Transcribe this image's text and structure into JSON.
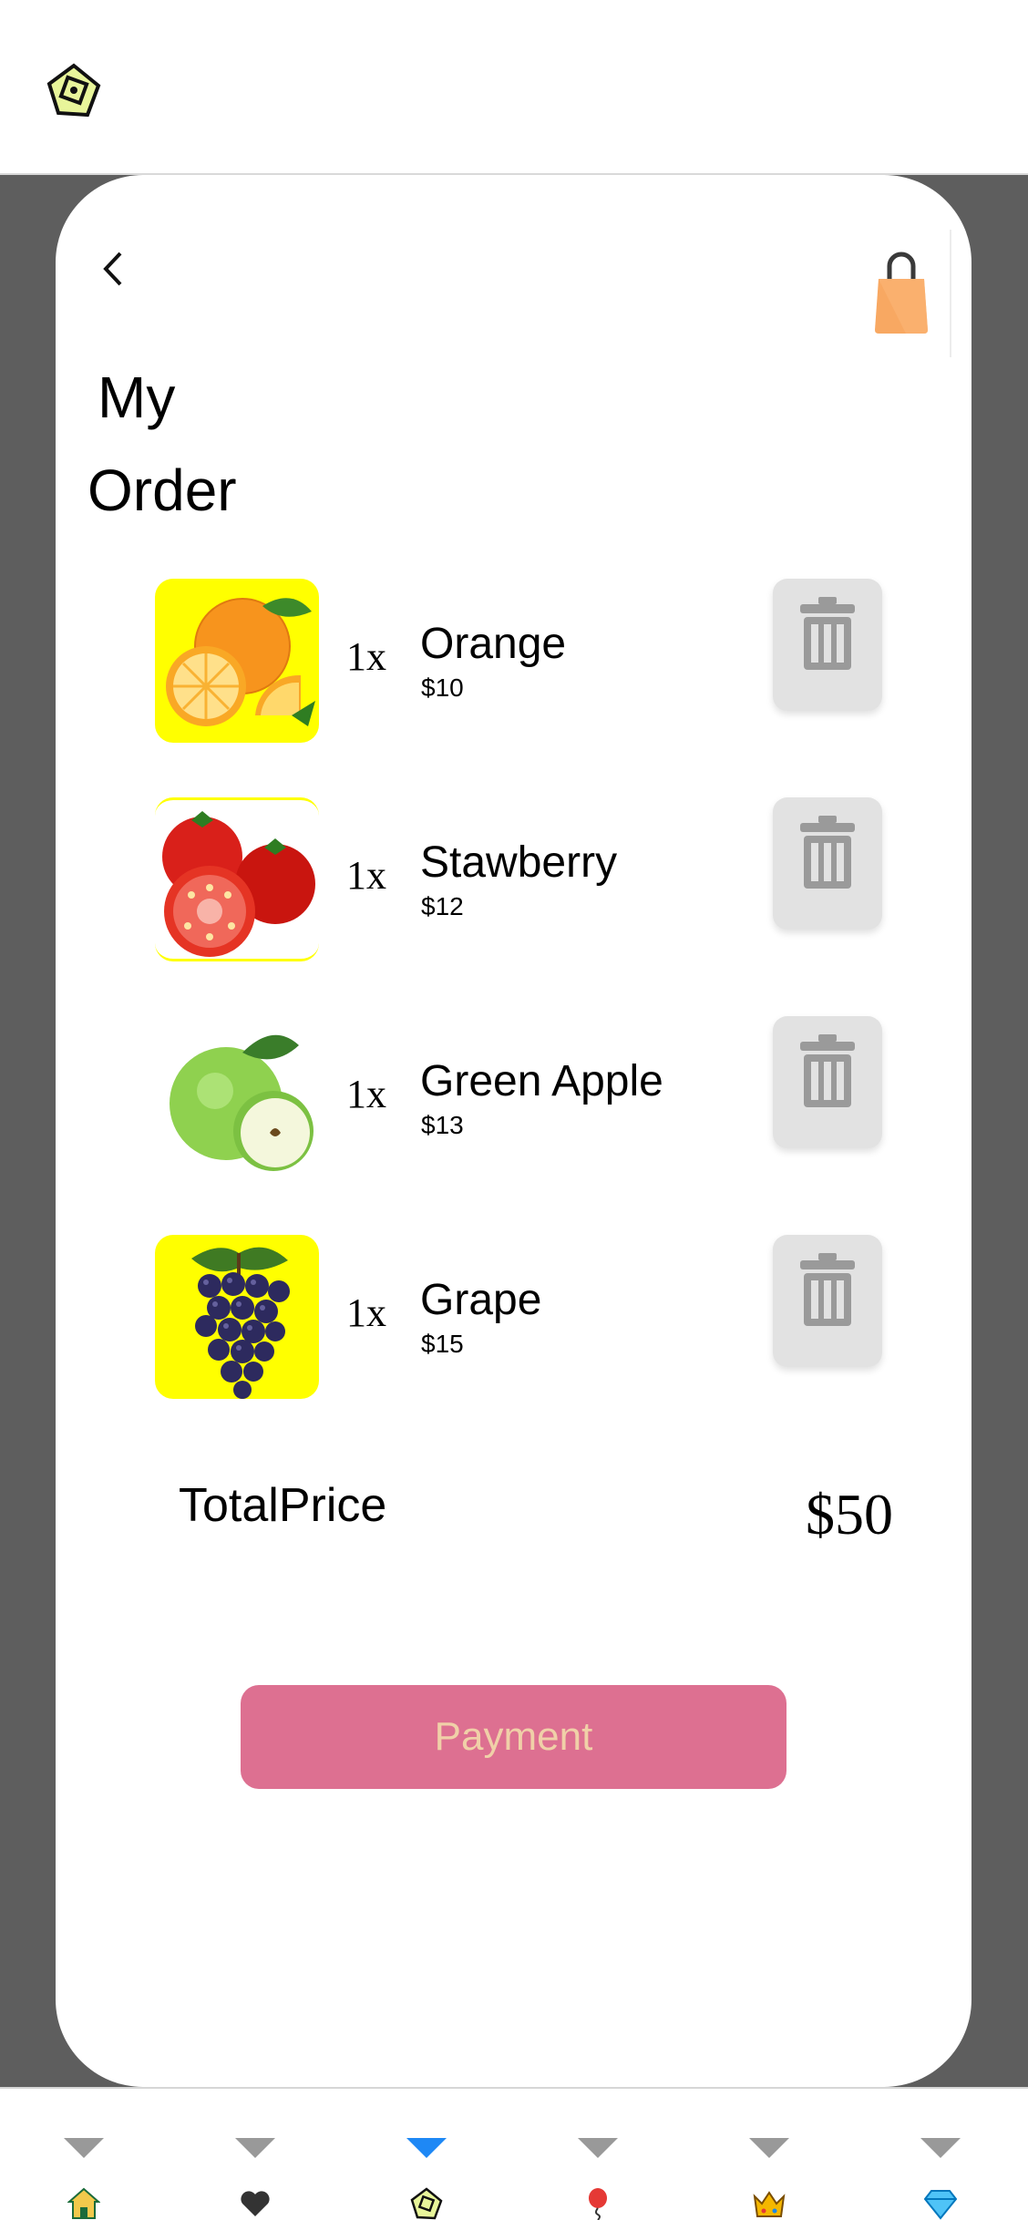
{
  "header": {
    "logo_icon": "app-logo-icon"
  },
  "card": {
    "back_icon": "chevron-left-icon",
    "bag_icon": "shopping-bag-icon",
    "title_line1": "My",
    "title_line2": "Order"
  },
  "order_items": [
    {
      "qty": "1x",
      "name": "Orange",
      "price": "$10",
      "image": "orange-image",
      "bg": "#ffff00"
    },
    {
      "qty": "1x",
      "name": "Stawberry",
      "price": "$12",
      "image": "tomato-image",
      "bg": "#ffffff"
    },
    {
      "qty": "1x",
      "name": "Green Apple",
      "price": "$13",
      "image": "green-apple-image",
      "bg": "#ffffff"
    },
    {
      "qty": "1x",
      "name": "Grape",
      "price": "$15",
      "image": "grape-image",
      "bg": "#ffff00"
    }
  ],
  "summary": {
    "total_label": "TotalPrice",
    "total_value": "$50"
  },
  "payment": {
    "label": "Payment",
    "color": "#dd7091"
  },
  "tabbar": {
    "active_index": 2,
    "active_color": "#1e88f5",
    "tabs": [
      {
        "icon": "house-icon"
      },
      {
        "icon": "heart-icon"
      },
      {
        "icon": "app-logo-icon"
      },
      {
        "icon": "balloon-icon"
      },
      {
        "icon": "crown-icon"
      },
      {
        "icon": "diamond-icon"
      }
    ]
  }
}
